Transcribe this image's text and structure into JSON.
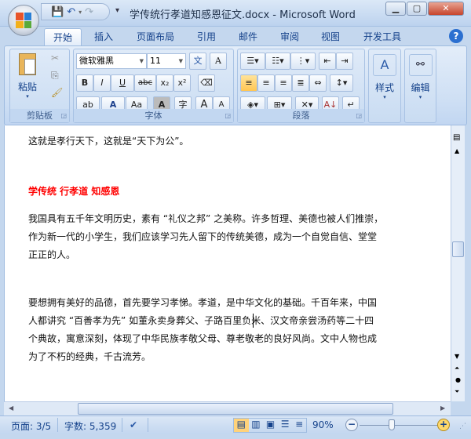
{
  "window": {
    "title": "学传统行孝道知感恩征文.docx - Microsoft Word"
  },
  "tabs": [
    "开始",
    "插入",
    "页面布局",
    "引用",
    "邮件",
    "审阅",
    "视图",
    "开发工具"
  ],
  "ribbon": {
    "clipboard": {
      "label": "剪贴板",
      "paste": "粘贴"
    },
    "font": {
      "label": "字体",
      "font_name": "微软雅黑",
      "font_size": "11",
      "phonetic": "文",
      "bold": "B",
      "italic": "I",
      "underline": "U",
      "strike": "abc",
      "subscript": "x₂",
      "superscript": "x²",
      "font_color": "A",
      "change_case": "Aa",
      "char_shading": "A",
      "enclose": "字",
      "grow": "A",
      "shrink": "A"
    },
    "paragraph": {
      "label": "段落"
    },
    "styles": {
      "label": "样式"
    },
    "editing": {
      "label": "编辑"
    }
  },
  "document": {
    "lines": [
      "这就是孝行天下，这就是“天下为公”。",
      "学传统 行孝道 知感恩",
      " 我国具有五千年文明历史，素有 “礼仪之邦” 之美称。许多哲理、美德也被人们推崇，",
      "作为新一代的小学生，我们应该学习先人留下的传统美德，成为一个自觉自信、堂堂",
      "正正的人。",
      "  要想拥有美好的品德，首先要学习孝悌。孝道，是中华文化的基础。千百年来，中国",
      "人都讲究 “百善孝为先” 如董永卖身葬父、子路百里负米、汉文帝亲尝汤药等二十四",
      "个典故，寓意深刻，体现了中华民族孝敬父母、尊老敬老的良好风尚。文中人物也成",
      "为了不朽的经典，千古流芳。"
    ],
    "heading_color": "#ff0000"
  },
  "status": {
    "page": "页面: 3/5",
    "words": "字数: 5,359",
    "zoom": "90%",
    "zoom_percent": 90
  }
}
